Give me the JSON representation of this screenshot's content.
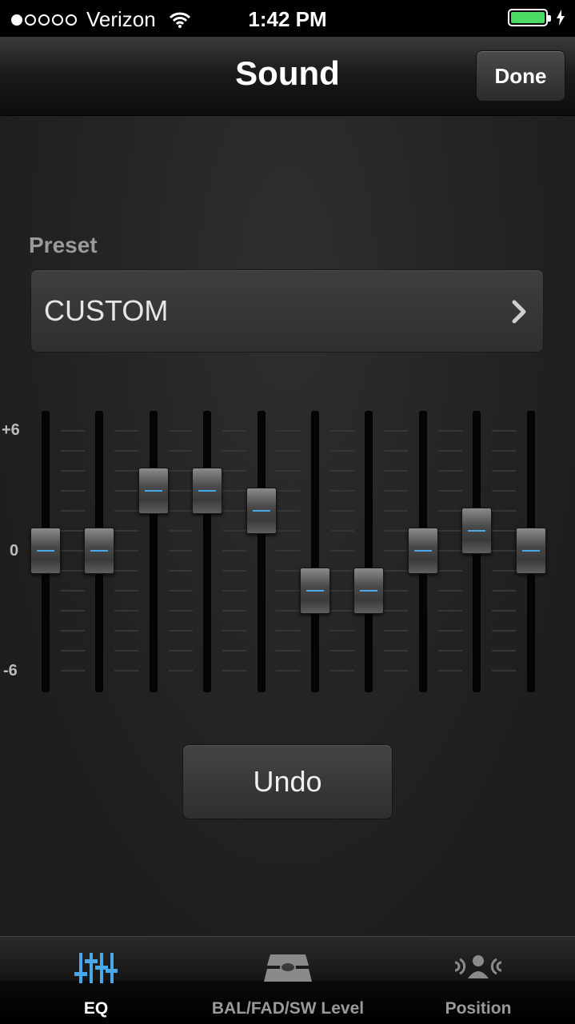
{
  "status_bar": {
    "carrier": "Verizon",
    "signal_dots_filled": 1,
    "signal_dots_total": 5,
    "time": "1:42 PM",
    "battery_level": 1.0,
    "battery_color": "#4cd964"
  },
  "nav": {
    "title": "Sound",
    "done_label": "Done"
  },
  "preset": {
    "label": "Preset",
    "value": "CUSTOM"
  },
  "eq": {
    "scale_labels": [
      "+6",
      "0",
      "-6"
    ],
    "range": [
      -6,
      6
    ],
    "band_values": [
      0,
      0,
      3,
      3,
      2,
      -2,
      -2,
      0,
      1,
      0
    ],
    "knob_indicator_color": "#4aa8e8"
  },
  "undo_label": "Undo",
  "tabs": [
    {
      "label": "EQ",
      "icon": "eq-sliders-icon",
      "active": true
    },
    {
      "label": "BAL/FAD/SW Level",
      "icon": "car-seats-icon",
      "active": false
    },
    {
      "label": "Position",
      "icon": "listener-position-icon",
      "active": false
    }
  ],
  "accent_color": "#4aa8e8"
}
